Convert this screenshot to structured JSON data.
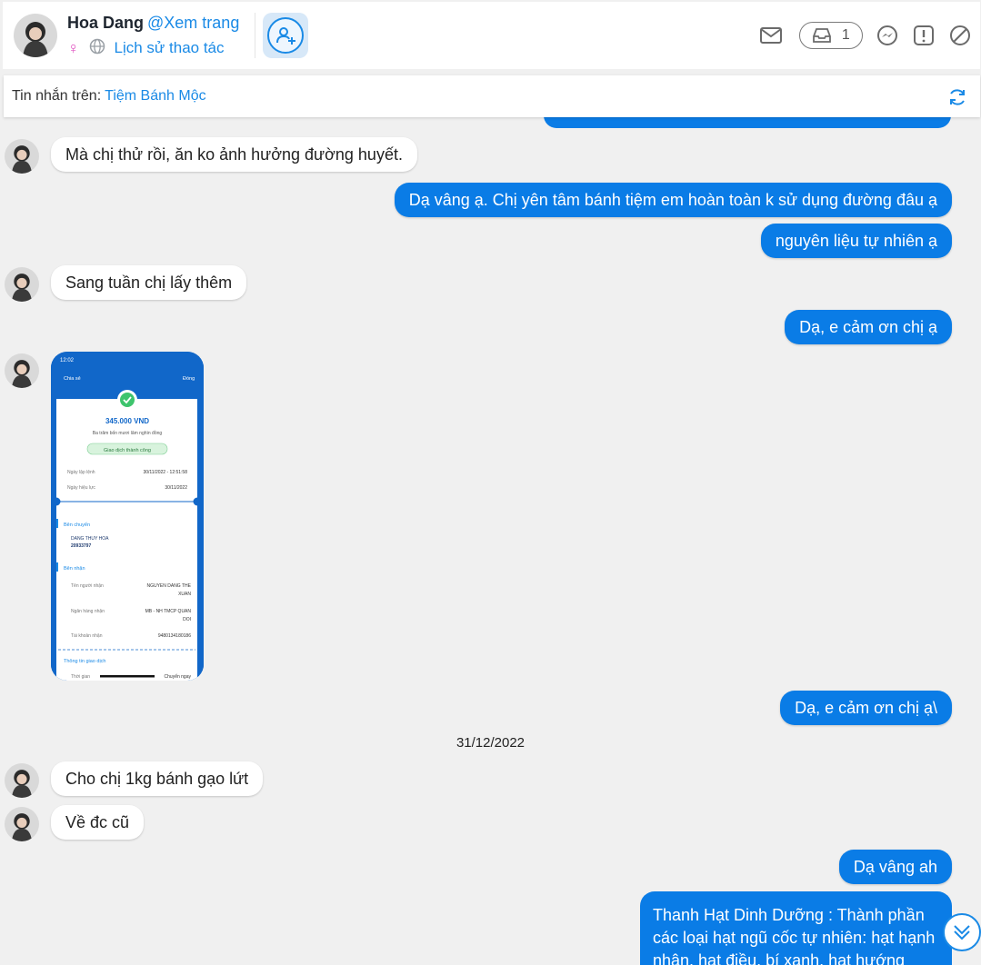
{
  "header": {
    "name": "Hoa Dang",
    "view_page": "@Xem trang",
    "history": "Lịch sử thao tác",
    "inbox_count": "1",
    "icons": [
      "mail-icon",
      "inbox-icon",
      "messenger-icon",
      "report-icon",
      "block-icon"
    ]
  },
  "subbar": {
    "label": "Tin nhắn trên:",
    "page_name": "Tiệm Bánh Mộc"
  },
  "messages": [
    {
      "side": "in",
      "text": "Mà chị thử rồi, ăn ko ảnh hưởng đường huyết."
    },
    {
      "side": "out",
      "text": "Dạ vâng ạ. Chị yên tâm bánh tiệm em hoàn toàn k sử dụng đường đâu ạ"
    },
    {
      "side": "out",
      "text": "nguyên liệu tự nhiên ạ"
    },
    {
      "side": "in",
      "text": "Sang tuần chị lấy thêm"
    },
    {
      "side": "out",
      "text": "Dạ, e cảm ơn chị ạ"
    },
    {
      "side": "out",
      "text": "Dạ, e cảm ơn chị ạ\\"
    },
    {
      "side": "in",
      "text": "Cho chị 1kg bánh gạo lứt"
    },
    {
      "side": "in",
      "text": "Về đc cũ"
    },
    {
      "side": "out",
      "text": "Dạ vâng ah"
    },
    {
      "side": "out",
      "text": "Thanh Hạt Dinh Dưỡng : Thành phần các loại hạt ngũ cốc tự nhiên: hạt hạnh nhân, hạt điều, bí xanh, hạt hướng"
    }
  ],
  "date_separator": "31/12/2022",
  "receipt": {
    "time": "12:02",
    "share": "Chia sẻ",
    "close": "Đóng",
    "amount": "345.000 VND",
    "amount_words": "Ba trăm bốn mươi lăm nghìn đồng",
    "status": "Giao dịch thành công",
    "created_label": "Ngày lập lệnh",
    "created_value": "30/11/2022 - 12:51:58",
    "effective_label": "Ngày hiệu lực",
    "effective_value": "30/11/2022",
    "sender_section": "Bên chuyển",
    "sender_name": "DANG THUY HOA",
    "sender_account": "20933797",
    "receiver_section": "Bên nhận",
    "receiver_name_label": "Tên người nhận",
    "receiver_name_line1": "NGUYEN DANG THE",
    "receiver_name_line2": "XUAN",
    "bank_label": "Ngân hàng nhận",
    "bank_line1": "MB - NH TMCP QUAN",
    "bank_line2": "DOI",
    "account_label": "Tài khoản nhận",
    "account_value": "9480134180186",
    "tx_section": "Thông tin giao dịch",
    "tx_time_label": "Thời gian",
    "tx_time_value": "Chuyển ngay"
  },
  "colors": {
    "accent": "#1a8ae6",
    "bubble_out": "#0a7ce6",
    "background": "#f0f0f0"
  }
}
